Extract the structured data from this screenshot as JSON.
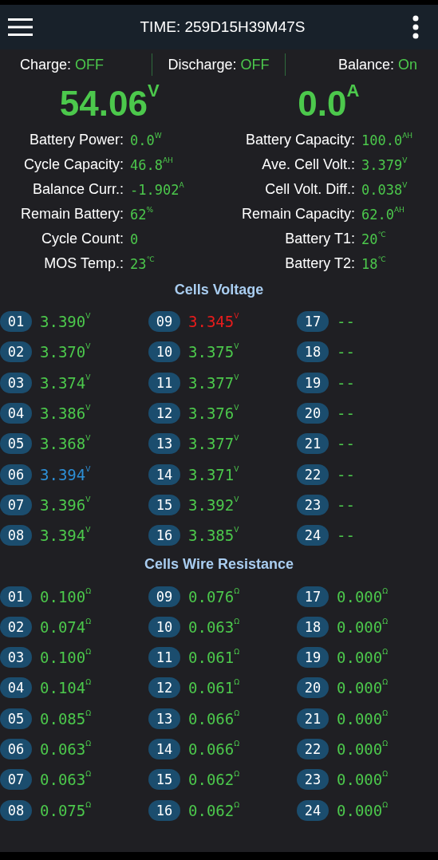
{
  "header": {
    "title": "TIME: 259D15H39M47S"
  },
  "switches": [
    {
      "label": "Charge:",
      "value": "OFF"
    },
    {
      "label": "Discharge:",
      "value": "OFF"
    },
    {
      "label": "Balance:",
      "value": "On"
    }
  ],
  "main_readings": [
    {
      "value": "54.06",
      "unit": "V"
    },
    {
      "value": "0.0",
      "unit": "A"
    }
  ],
  "stats": [
    {
      "label": "Battery Power:",
      "value": "0.0",
      "unit": "W"
    },
    {
      "label": "Battery Capacity:",
      "value": "100.0",
      "unit": "AH"
    },
    {
      "label": "Cycle Capacity:",
      "value": "46.8",
      "unit": "AH"
    },
    {
      "label": "Ave. Cell Volt.:",
      "value": "3.379",
      "unit": "V"
    },
    {
      "label": "Balance Curr.:",
      "value": "-1.902",
      "unit": "A"
    },
    {
      "label": "Cell Volt. Diff.:",
      "value": "0.038",
      "unit": "V"
    },
    {
      "label": "Remain Battery:",
      "value": "62",
      "unit": "%"
    },
    {
      "label": "Remain Capacity:",
      "value": "62.0",
      "unit": "AH"
    },
    {
      "label": "Cycle Count:",
      "value": "0"
    },
    {
      "label": "Battery T1:",
      "value": "20",
      "unit": "℃"
    },
    {
      "label": "MOS Temp.:",
      "value": "23",
      "unit": "℃"
    },
    {
      "label": "Battery T2:",
      "value": "18",
      "unit": "℃"
    }
  ],
  "sections": [
    {
      "title": "Cells Voltage",
      "cells": [
        {
          "index": "01",
          "value": "3.390",
          "unit": "V",
          "color": "#4cc84c"
        },
        {
          "index": "09",
          "value": "3.345",
          "unit": "V",
          "color": "#e81c1c"
        },
        {
          "index": "17",
          "value": "--"
        },
        {
          "index": "02",
          "value": "3.370",
          "unit": "V",
          "color": "#4cc84c"
        },
        {
          "index": "10",
          "value": "3.375",
          "unit": "V",
          "color": "#4cc84c"
        },
        {
          "index": "18",
          "value": "--"
        },
        {
          "index": "03",
          "value": "3.374",
          "unit": "V",
          "color": "#4cc84c"
        },
        {
          "index": "11",
          "value": "3.377",
          "unit": "V",
          "color": "#4cc84c"
        },
        {
          "index": "19",
          "value": "--"
        },
        {
          "index": "04",
          "value": "3.386",
          "unit": "V",
          "color": "#4cc84c"
        },
        {
          "index": "12",
          "value": "3.376",
          "unit": "V",
          "color": "#4cc84c"
        },
        {
          "index": "20",
          "value": "--"
        },
        {
          "index": "05",
          "value": "3.368",
          "unit": "V",
          "color": "#4cc84c"
        },
        {
          "index": "13",
          "value": "3.377",
          "unit": "V",
          "color": "#4cc84c"
        },
        {
          "index": "21",
          "value": "--"
        },
        {
          "index": "06",
          "value": "3.394",
          "unit": "V",
          "color": "#2d8fd6"
        },
        {
          "index": "14",
          "value": "3.371",
          "unit": "V",
          "color": "#4cc84c"
        },
        {
          "index": "22",
          "value": "--"
        },
        {
          "index": "07",
          "value": "3.396",
          "unit": "V",
          "color": "#4cc84c"
        },
        {
          "index": "15",
          "value": "3.392",
          "unit": "V",
          "color": "#4cc84c"
        },
        {
          "index": "23",
          "value": "--"
        },
        {
          "index": "08",
          "value": "3.394",
          "unit": "V",
          "color": "#4cc84c"
        },
        {
          "index": "16",
          "value": "3.385",
          "unit": "V",
          "color": "#4cc84c"
        },
        {
          "index": "24",
          "value": "--"
        }
      ]
    },
    {
      "title": "Cells Wire Resistance",
      "cells": [
        {
          "index": "01",
          "value": "0.100",
          "unit": "Ω"
        },
        {
          "index": "09",
          "value": "0.076",
          "unit": "Ω"
        },
        {
          "index": "17",
          "value": "0.000",
          "unit": "Ω"
        },
        {
          "index": "02",
          "value": "0.074",
          "unit": "Ω"
        },
        {
          "index": "10",
          "value": "0.063",
          "unit": "Ω"
        },
        {
          "index": "18",
          "value": "0.000",
          "unit": "Ω"
        },
        {
          "index": "03",
          "value": "0.100",
          "unit": "Ω"
        },
        {
          "index": "11",
          "value": "0.061",
          "unit": "Ω"
        },
        {
          "index": "19",
          "value": "0.000",
          "unit": "Ω"
        },
        {
          "index": "04",
          "value": "0.104",
          "unit": "Ω"
        },
        {
          "index": "12",
          "value": "0.061",
          "unit": "Ω"
        },
        {
          "index": "20",
          "value": "0.000",
          "unit": "Ω"
        },
        {
          "index": "05",
          "value": "0.085",
          "unit": "Ω"
        },
        {
          "index": "13",
          "value": "0.066",
          "unit": "Ω"
        },
        {
          "index": "21",
          "value": "0.000",
          "unit": "Ω"
        },
        {
          "index": "06",
          "value": "0.063",
          "unit": "Ω"
        },
        {
          "index": "14",
          "value": "0.066",
          "unit": "Ω"
        },
        {
          "index": "22",
          "value": "0.000",
          "unit": "Ω"
        },
        {
          "index": "07",
          "value": "0.063",
          "unit": "Ω"
        },
        {
          "index": "15",
          "value": "0.062",
          "unit": "Ω"
        },
        {
          "index": "23",
          "value": "0.000",
          "unit": "Ω"
        },
        {
          "index": "08",
          "value": "0.075",
          "unit": "Ω"
        },
        {
          "index": "16",
          "value": "0.062",
          "unit": "Ω"
        },
        {
          "index": "24",
          "value": "0.000",
          "unit": "Ω"
        }
      ]
    }
  ]
}
